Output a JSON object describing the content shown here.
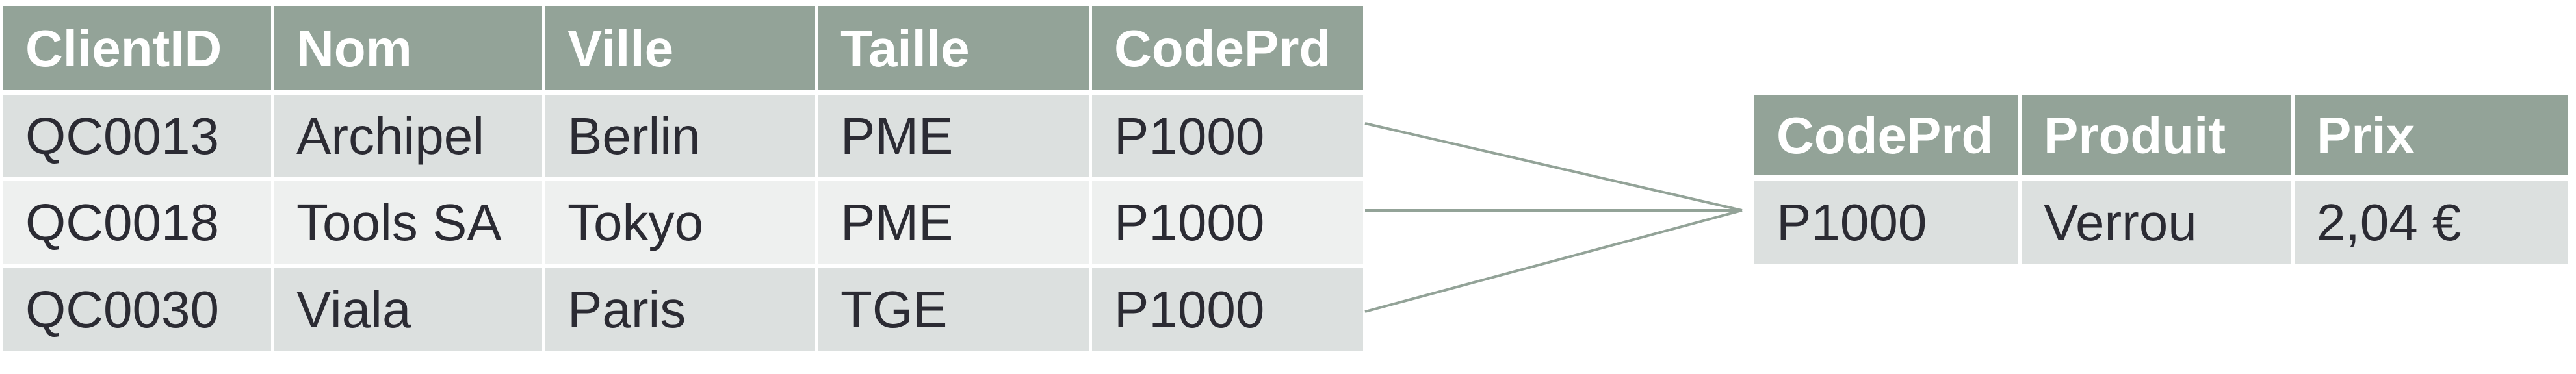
{
  "clients_table": {
    "headers": [
      "ClientID",
      "Nom",
      "Ville",
      "Taille",
      "CodePrd"
    ],
    "rows": [
      [
        "QC0013",
        "Archipel",
        "Berlin",
        "PME",
        "P1000"
      ],
      [
        "QC0018",
        "Tools SA",
        "Tokyo",
        "PME",
        "P1000"
      ],
      [
        "QC0030",
        "Viala",
        "Paris",
        "TGE",
        "P1000"
      ]
    ]
  },
  "products_table": {
    "headers": [
      "CodePrd",
      "Produit",
      "Prix"
    ],
    "rows": [
      [
        "P1000",
        "Verrou",
        "2,04 €"
      ]
    ]
  },
  "relation": {
    "type": "many-to-one",
    "from": "clients_table.CodePrd",
    "to": "products_table.CodePrd"
  },
  "colors": {
    "header_bg": "#93a398",
    "header_text": "#ffffff",
    "row_odd_bg": "#dce0df",
    "row_even_bg": "#eef0ef",
    "body_text": "#2b2b33",
    "connector": "#93a398"
  }
}
